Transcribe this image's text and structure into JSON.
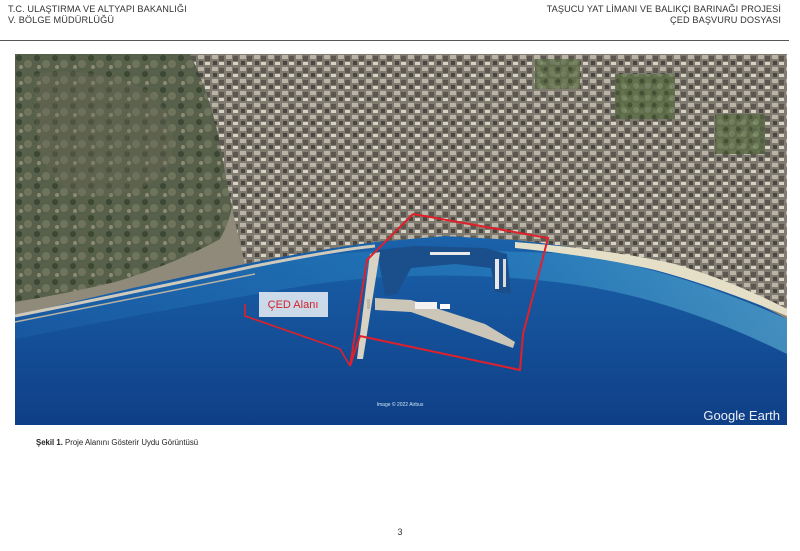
{
  "header": {
    "left_line1": "T.C. ULAŞTIRMA VE ALTYAPI BAKANLIĞI",
    "left_line2": "V. BÖLGE MÜDÜRLÜĞÜ",
    "right_line1": "TAŞUCU YAT LİMANI VE BALIKÇI BARINAĞI PROJESİ",
    "right_line2": "ÇED BAŞVURU DOSYASI"
  },
  "figure": {
    "area_label": "ÇED Alanı",
    "imagery_credit": "Image © 2022 Airbus",
    "watermark": "Google Earth",
    "colors": {
      "sea_deep": "#0f3f86",
      "sea_mid": "#1d6cb5",
      "sea_shallow": "#5fb2d6",
      "land": "#8f8a7a",
      "hills": "#4d5a3e",
      "boundary": "#e0202a"
    }
  },
  "caption": {
    "number": "Şekil 1.",
    "text": "Proje Alanını Gösterir Uydu Görüntüsü"
  },
  "page_number": "3"
}
